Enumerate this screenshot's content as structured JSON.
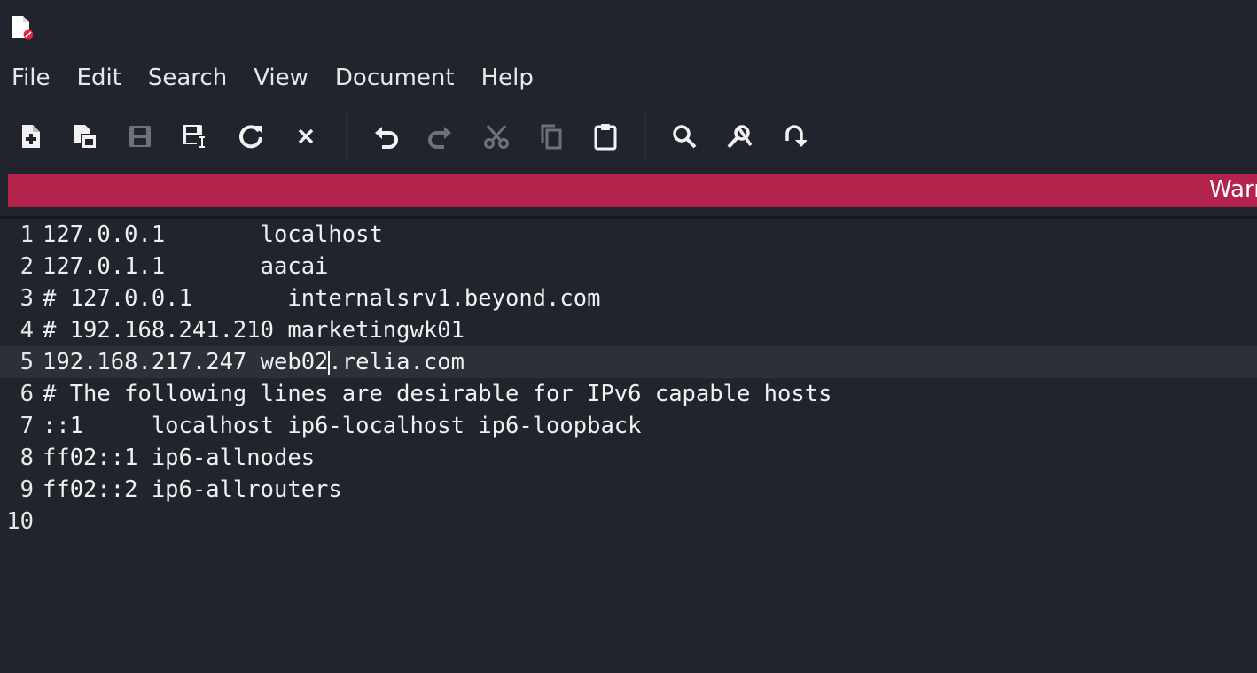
{
  "window": {
    "icon": "document-error-icon"
  },
  "menubar": {
    "items": [
      "File",
      "Edit",
      "Search",
      "View",
      "Document",
      "Help"
    ]
  },
  "toolbar": {
    "buttons": [
      {
        "icon": "new-document-icon"
      },
      {
        "icon": "new-window-icon"
      },
      {
        "icon": "save-icon"
      },
      {
        "icon": "save-as-icon"
      },
      {
        "icon": "reload-icon"
      },
      {
        "icon": "close-icon"
      },
      {
        "icon": "undo-icon"
      },
      {
        "icon": "redo-icon"
      },
      {
        "icon": "cut-icon"
      },
      {
        "icon": "copy-icon"
      },
      {
        "icon": "paste-icon"
      },
      {
        "icon": "search-icon"
      },
      {
        "icon": "find-replace-icon"
      },
      {
        "icon": "goto-line-icon"
      }
    ]
  },
  "warning": {
    "text": "Warning"
  },
  "editor": {
    "current_line": 5,
    "lines": [
      {
        "number": "1",
        "text": "127.0.0.1       localhost"
      },
      {
        "number": "2",
        "text": "127.0.1.1       aacai"
      },
      {
        "number": "3",
        "text": "# 127.0.0.1       internalsrv1.beyond.com"
      },
      {
        "number": "4",
        "text": "# 192.168.241.210 marketingwk01"
      },
      {
        "number": "5",
        "text": "192.168.217.247 web02.relia.com"
      },
      {
        "number": "6",
        "text": "# The following lines are desirable for IPv6 capable hosts"
      },
      {
        "number": "7",
        "text": "::1     localhost ip6-localhost ip6-loopback"
      },
      {
        "number": "8",
        "text": "ff02::1 ip6-allnodes"
      },
      {
        "number": "9",
        "text": "ff02::2 ip6-allrouters"
      },
      {
        "number": "10",
        "text": ""
      }
    ]
  },
  "colors": {
    "background": "#21242d",
    "warning_bar": "#b3234b",
    "current_line": "#2d3038"
  }
}
